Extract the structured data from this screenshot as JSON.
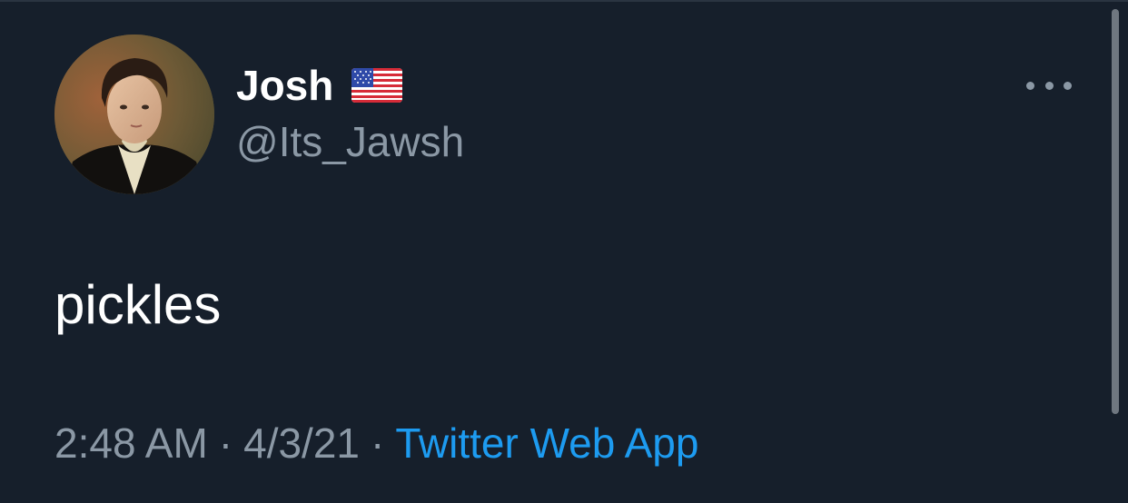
{
  "user": {
    "display_name": "Josh",
    "handle": "@Its_Jawsh",
    "flag_icon": "us-flag-icon"
  },
  "tweet": {
    "text": "pickles",
    "time": "2:48 AM",
    "separator": "·",
    "date": "4/3/21",
    "source": "Twitter Web App"
  },
  "colors": {
    "background": "#161f2b",
    "primary_text": "#ffffff",
    "secondary_text": "#8b98a5",
    "link": "#1d9bf0"
  }
}
